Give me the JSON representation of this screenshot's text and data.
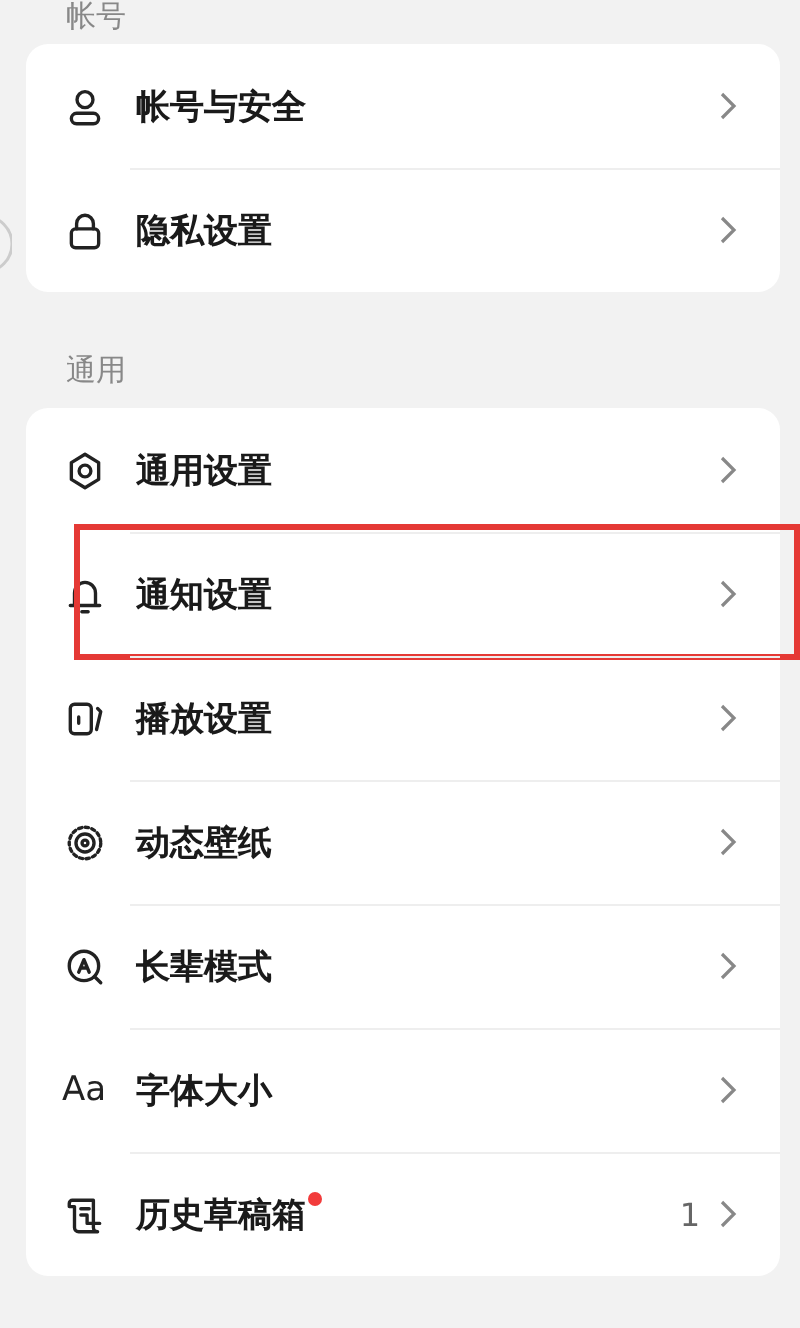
{
  "sections": [
    {
      "title": "帐号",
      "items": [
        {
          "label": "帐号与安全",
          "annotated": false
        },
        {
          "label": "隐私设置",
          "annotated": false
        }
      ]
    },
    {
      "title": "通用",
      "items": [
        {
          "label": "通用设置",
          "annotated": false
        },
        {
          "label": "通知设置",
          "annotated": true
        },
        {
          "label": "播放设置",
          "annotated": false
        },
        {
          "label": "动态壁纸",
          "annotated": false
        },
        {
          "label": "长辈模式",
          "annotated": false
        },
        {
          "label": "字体大小",
          "annotated": false,
          "icon_text": "Aa"
        },
        {
          "label": "历史草稿箱",
          "annotated": false,
          "new_dot": true,
          "value": "1"
        }
      ]
    }
  ]
}
